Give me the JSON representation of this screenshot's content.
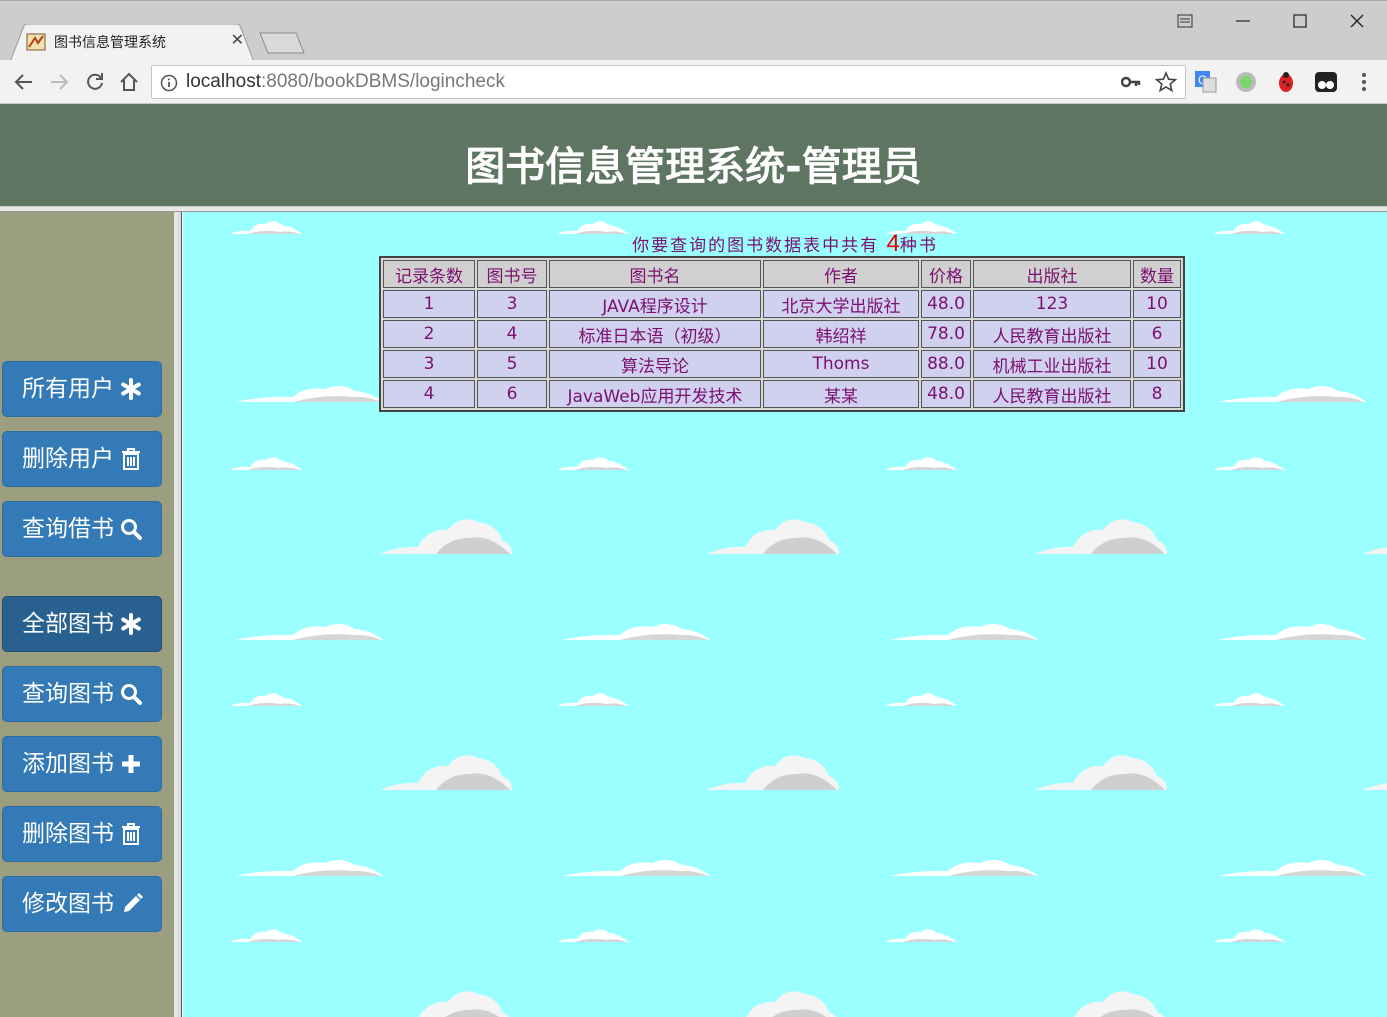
{
  "browser": {
    "tab_title": "图书信息管理系统",
    "url_host": "localhost",
    "url_rest": ":8080/bookDBMS/logincheck"
  },
  "header": {
    "title": "图书信息管理系统-管理员"
  },
  "sidebar": {
    "items": [
      {
        "label": "所有用户",
        "icon": "asterisk-icon"
      },
      {
        "label": "删除用户",
        "icon": "trash-icon"
      },
      {
        "label": "查询借书",
        "icon": "search-icon"
      },
      {
        "label": "全部图书",
        "icon": "asterisk-icon",
        "active": true
      },
      {
        "label": "查询图书",
        "icon": "search-icon"
      },
      {
        "label": "添加图书",
        "icon": "plus-icon"
      },
      {
        "label": "删除图书",
        "icon": "trash-icon"
      },
      {
        "label": "修改图书",
        "icon": "pencil-icon"
      }
    ]
  },
  "main": {
    "summary_prefix": "你要查询的图书数据表中共有",
    "summary_count": "4",
    "summary_suffix": "种书",
    "table": {
      "headers": [
        "记录条数",
        "图书号",
        "图书名",
        "作者",
        "价格",
        "出版社",
        "数量"
      ],
      "rows": [
        [
          "1",
          "3",
          "JAVA程序设计",
          "北京大学出版社",
          "48.0",
          "123",
          "10"
        ],
        [
          "2",
          "4",
          "标准日本语（初级）",
          "韩绍祥",
          "78.0",
          "人民教育出版社",
          "6"
        ],
        [
          "3",
          "5",
          "算法导论",
          "Thoms",
          "88.0",
          "机械工业出版社",
          "10"
        ],
        [
          "4",
          "6",
          "JavaWeb应用开发技术",
          "某某",
          "48.0",
          "人民教育出版社",
          "8"
        ]
      ]
    }
  },
  "colors": {
    "header_bg": "#5e7561",
    "sidebar_bg": "#9c9e80",
    "content_bg": "#9bffff",
    "button_bg": "#337ab7",
    "text_purple": "#7b1070",
    "count_red": "#e00000"
  }
}
